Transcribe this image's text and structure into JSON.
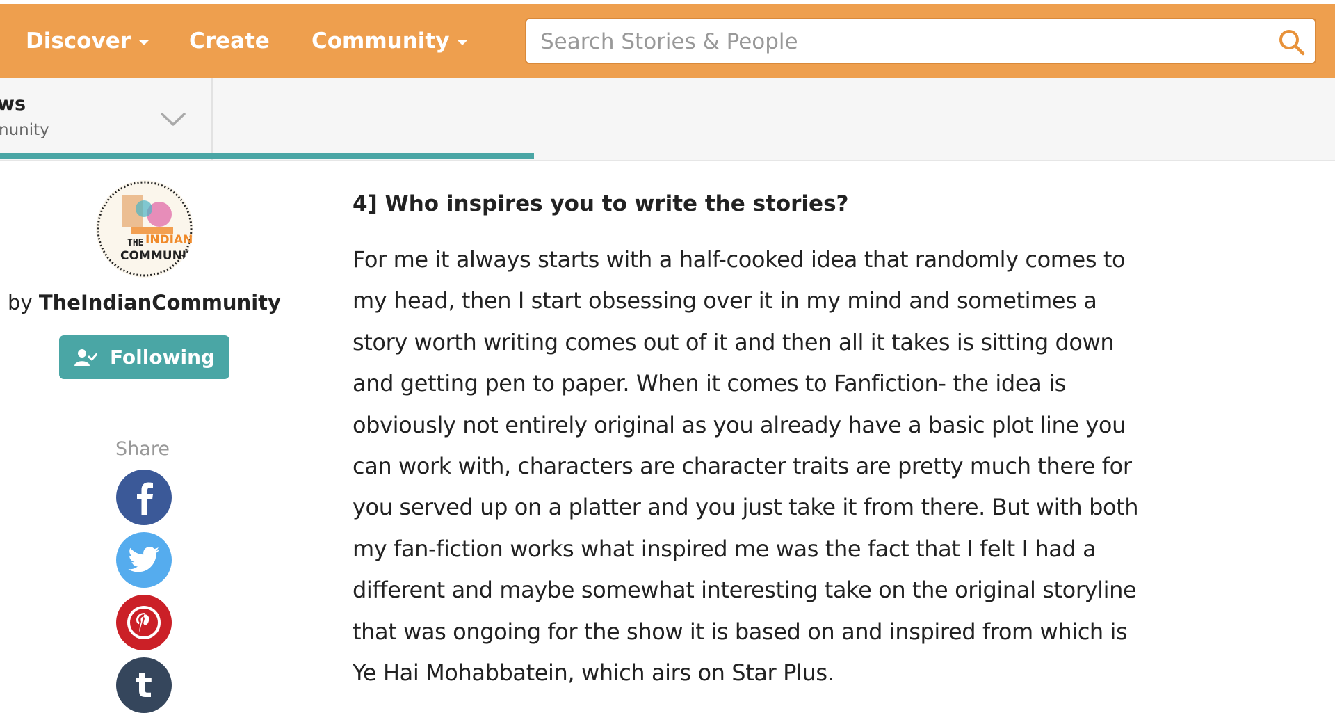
{
  "nav": {
    "discover": "Discover",
    "create": "Create",
    "community": "Community",
    "search_placeholder": "Search Stories & People"
  },
  "story_bar": {
    "title_fragment": "ws",
    "author_fragment": "nunity",
    "reading_progress_percent": 40
  },
  "author": {
    "by_prefix": "by",
    "name": "TheIndianCommunity",
    "follow_label": "Following",
    "avatar_text_1": "THE",
    "avatar_text_2": "INDIAN",
    "avatar_text_3": "COMMUNITY"
  },
  "share": {
    "label": "Share",
    "networks": [
      "facebook-icon",
      "twitter-icon",
      "pinterest-icon",
      "tumblr-icon"
    ]
  },
  "content": {
    "question": "4] Who inspires you to write the stories?",
    "answer_lines": [
      "For me it always starts with a half-cooked idea that randomly comes to",
      "my head, then I start obsessing over it in my mind and sometimes a",
      "story worth writing comes out of it and then all it takes is sitting down",
      "and getting pen to paper. When it comes to Fanfiction- the idea is",
      "obviously not entirely original as you already have a basic plot line you",
      "can work with, characters are character traits are pretty much there for",
      "you served up on a platter and you just take it from there. But with both",
      "my fan-fiction works what inspired me was the fact that I felt I had a",
      "different and maybe somewhat interesting take on the original storyline",
      "that was ongoing for the show it is based on and inspired from which is",
      "Ye Hai Mohabbatein, which airs on Star Plus."
    ]
  },
  "colors": {
    "nav_orange": "#ee9f4e",
    "teal": "#4aa6a5",
    "facebook": "#3b5998",
    "twitter": "#55acee",
    "pinterest": "#cb2027",
    "tumblr": "#35465c"
  }
}
